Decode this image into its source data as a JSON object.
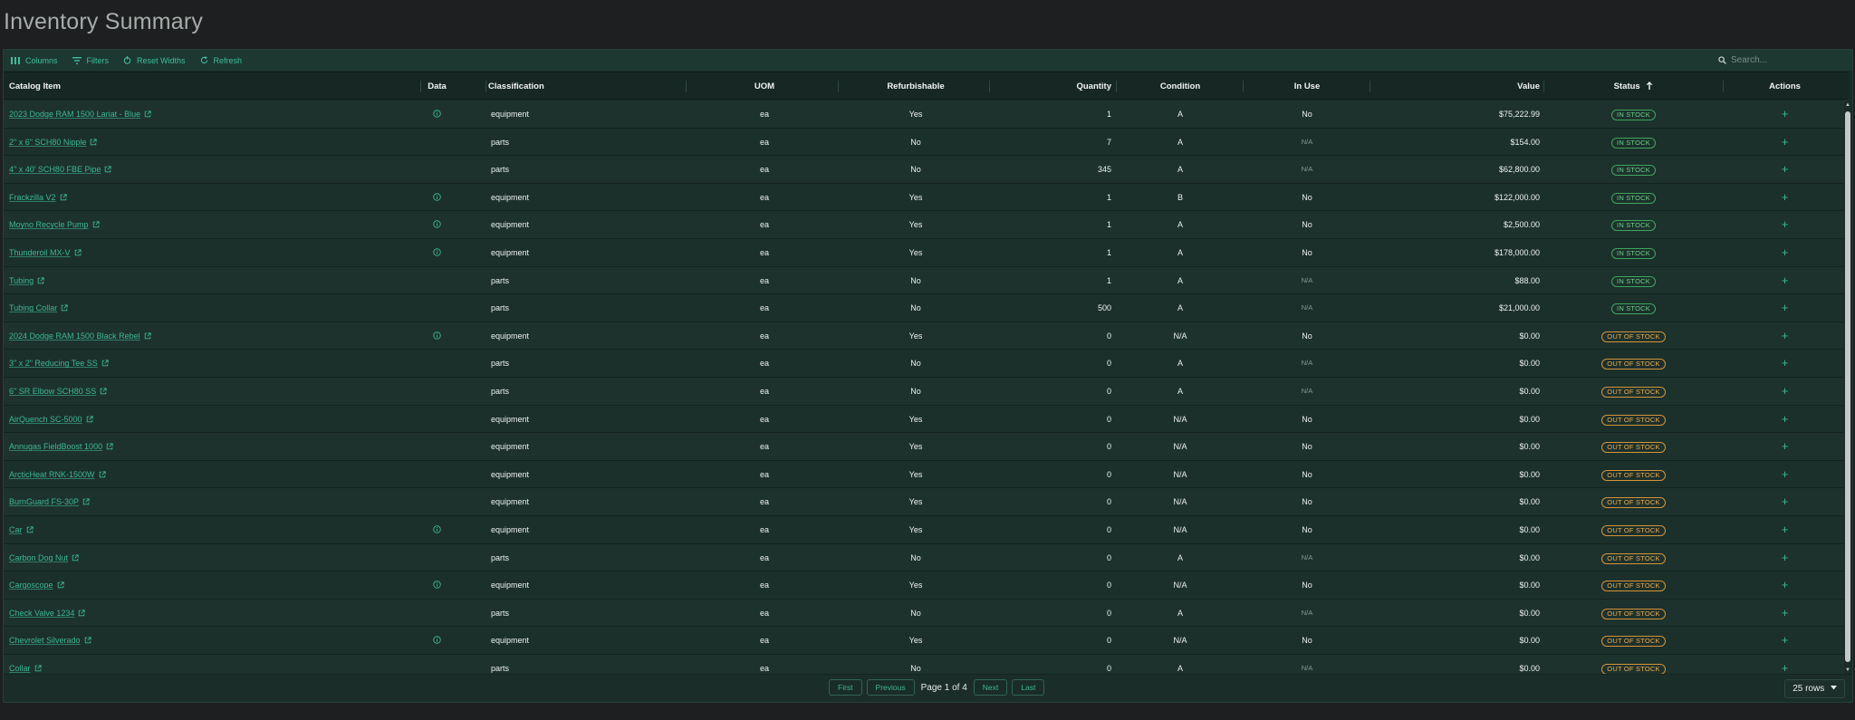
{
  "title": "Inventory Summary",
  "toolbar": {
    "columns": "Columns",
    "filters": "Filters",
    "reset_widths": "Reset Widths",
    "refresh": "Refresh",
    "search_placeholder": "Search..."
  },
  "columns": {
    "catalog_item": "Catalog Item",
    "data": "Data",
    "classification": "Classification",
    "uom": "UOM",
    "refurbishable": "Refurbishable",
    "quantity": "Quantity",
    "condition": "Condition",
    "in_use": "In Use",
    "value": "Value",
    "status": "Status",
    "actions": "Actions"
  },
  "sort": {
    "column": "Status",
    "direction": "ascending",
    "icon": "arrow-up-icon"
  },
  "rows": [
    {
      "item": "2023 Dodge RAM 1500 Lariat - Blue",
      "data": true,
      "classification": "equipment",
      "uom": "ea",
      "refurbishable": "Yes",
      "quantity": "1",
      "condition": "A",
      "in_use": "No",
      "value": "$75,222.99",
      "status": "IN STOCK"
    },
    {
      "item": "2\" x 6\" SCH80 Nipple",
      "data": false,
      "classification": "parts",
      "uom": "ea",
      "refurbishable": "No",
      "quantity": "7",
      "condition": "A",
      "in_use": "N/A",
      "value": "$154.00",
      "status": "IN STOCK"
    },
    {
      "item": "4\" x 40' SCH80 FBE Pipe",
      "data": false,
      "classification": "parts",
      "uom": "ea",
      "refurbishable": "No",
      "quantity": "345",
      "condition": "A",
      "in_use": "N/A",
      "value": "$62,800.00",
      "status": "IN STOCK"
    },
    {
      "item": "Frackzilla V2",
      "data": true,
      "classification": "equipment",
      "uom": "ea",
      "refurbishable": "Yes",
      "quantity": "1",
      "condition": "B",
      "in_use": "No",
      "value": "$122,000.00",
      "status": "IN STOCK"
    },
    {
      "item": "Moyno Recycle Pump",
      "data": true,
      "classification": "equipment",
      "uom": "ea",
      "refurbishable": "Yes",
      "quantity": "1",
      "condition": "A",
      "in_use": "No",
      "value": "$2,500.00",
      "status": "IN STOCK"
    },
    {
      "item": "Thunderoil MX-V",
      "data": true,
      "classification": "equipment",
      "uom": "ea",
      "refurbishable": "Yes",
      "quantity": "1",
      "condition": "A",
      "in_use": "No",
      "value": "$178,000.00",
      "status": "IN STOCK"
    },
    {
      "item": "Tubing",
      "data": false,
      "classification": "parts",
      "uom": "ea",
      "refurbishable": "No",
      "quantity": "1",
      "condition": "A",
      "in_use": "N/A",
      "value": "$88.00",
      "status": "IN STOCK"
    },
    {
      "item": "Tubing Collar",
      "data": false,
      "classification": "parts",
      "uom": "ea",
      "refurbishable": "No",
      "quantity": "500",
      "condition": "A",
      "in_use": "N/A",
      "value": "$21,000.00",
      "status": "IN STOCK"
    },
    {
      "item": "2024 Dodge RAM 1500 Black Rebel",
      "data": true,
      "classification": "equipment",
      "uom": "ea",
      "refurbishable": "Yes",
      "quantity": "0",
      "condition": "N/A",
      "in_use": "No",
      "value": "$0.00",
      "status": "OUT OF STOCK"
    },
    {
      "item": "3\" x 2\" Reducing Tee SS",
      "data": false,
      "classification": "parts",
      "uom": "ea",
      "refurbishable": "No",
      "quantity": "0",
      "condition": "A",
      "in_use": "N/A",
      "value": "$0.00",
      "status": "OUT OF STOCK"
    },
    {
      "item": "6\" SR Elbow SCH80 SS",
      "data": false,
      "classification": "parts",
      "uom": "ea",
      "refurbishable": "No",
      "quantity": "0",
      "condition": "A",
      "in_use": "N/A",
      "value": "$0.00",
      "status": "OUT OF STOCK"
    },
    {
      "item": "AirQuench SC-5000",
      "data": false,
      "classification": "equipment",
      "uom": "ea",
      "refurbishable": "Yes",
      "quantity": "0",
      "condition": "N/A",
      "in_use": "No",
      "value": "$0.00",
      "status": "OUT OF STOCK"
    },
    {
      "item": "Annugas FieldBoost 1000",
      "data": false,
      "classification": "equipment",
      "uom": "ea",
      "refurbishable": "Yes",
      "quantity": "0",
      "condition": "N/A",
      "in_use": "No",
      "value": "$0.00",
      "status": "OUT OF STOCK"
    },
    {
      "item": "ArcticHeat RNK-1500W",
      "data": false,
      "classification": "equipment",
      "uom": "ea",
      "refurbishable": "Yes",
      "quantity": "0",
      "condition": "N/A",
      "in_use": "No",
      "value": "$0.00",
      "status": "OUT OF STOCK"
    },
    {
      "item": "BurnGuard FS-30P",
      "data": false,
      "classification": "equipment",
      "uom": "ea",
      "refurbishable": "Yes",
      "quantity": "0",
      "condition": "N/A",
      "in_use": "No",
      "value": "$0.00",
      "status": "OUT OF STOCK"
    },
    {
      "item": "Car",
      "data": true,
      "classification": "equipment",
      "uom": "ea",
      "refurbishable": "Yes",
      "quantity": "0",
      "condition": "N/A",
      "in_use": "No",
      "value": "$0.00",
      "status": "OUT OF STOCK"
    },
    {
      "item": "Carbon Dog Nut",
      "data": false,
      "classification": "parts",
      "uom": "ea",
      "refurbishable": "No",
      "quantity": "0",
      "condition": "A",
      "in_use": "N/A",
      "value": "$0.00",
      "status": "OUT OF STOCK"
    },
    {
      "item": "Cargoscope",
      "data": true,
      "classification": "equipment",
      "uom": "ea",
      "refurbishable": "Yes",
      "quantity": "0",
      "condition": "N/A",
      "in_use": "No",
      "value": "$0.00",
      "status": "OUT OF STOCK"
    },
    {
      "item": "Check Valve 1234",
      "data": false,
      "classification": "parts",
      "uom": "ea",
      "refurbishable": "No",
      "quantity": "0",
      "condition": "A",
      "in_use": "N/A",
      "value": "$0.00",
      "status": "OUT OF STOCK"
    },
    {
      "item": "Chevrolet Silverado",
      "data": true,
      "classification": "equipment",
      "uom": "ea",
      "refurbishable": "Yes",
      "quantity": "0",
      "condition": "N/A",
      "in_use": "No",
      "value": "$0.00",
      "status": "OUT OF STOCK"
    },
    {
      "item": "Collar",
      "data": false,
      "classification": "parts",
      "uom": "ea",
      "refurbishable": "No",
      "quantity": "0",
      "condition": "A",
      "in_use": "N/A",
      "value": "$0.00",
      "status": "OUT OF STOCK"
    }
  ],
  "pagination": {
    "first": "First",
    "previous": "Previous",
    "page_text": "Page 1 of 4",
    "next": "Next",
    "last": "Last",
    "rows_per_page": "25 rows"
  },
  "colors": {
    "accent": "#3cb894",
    "in_stock": "#6ed08a",
    "out_of_stock": "#f0ac4e"
  }
}
